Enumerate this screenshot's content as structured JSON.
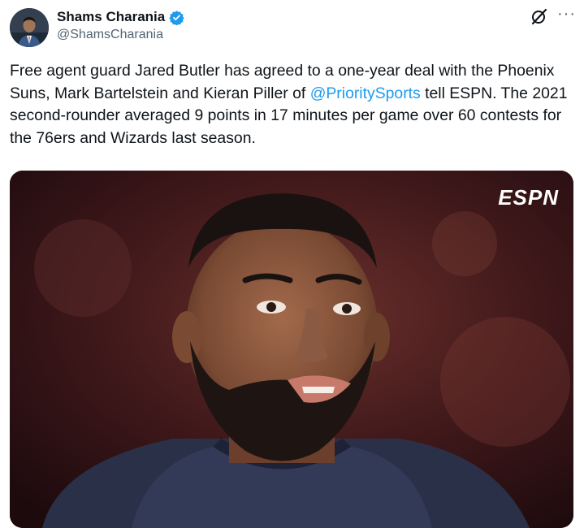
{
  "author": {
    "display_name": "Shams Charania",
    "handle": "@ShamsCharania",
    "verified": true
  },
  "icons": {
    "verified": "verified-badge-icon",
    "grok": "grok-icon",
    "more": "more-options-icon"
  },
  "tweet": {
    "text_before_mention": "Free agent guard Jared Butler has agreed to a one-year deal with the Phoenix Suns, Mark Bartelstein and Kieran Piller of ",
    "mention": "@PrioritySports",
    "text_after_mention": " tell ESPN. The 2021 second-rounder averaged 9 points in 17 minutes per game over 60 contests for the 76ers and Wizards last season."
  },
  "media": {
    "watermark": "ESPN"
  },
  "colors": {
    "link": "#1d9bf0",
    "verified": "#1d9bf0",
    "secondary_text": "#536471"
  }
}
